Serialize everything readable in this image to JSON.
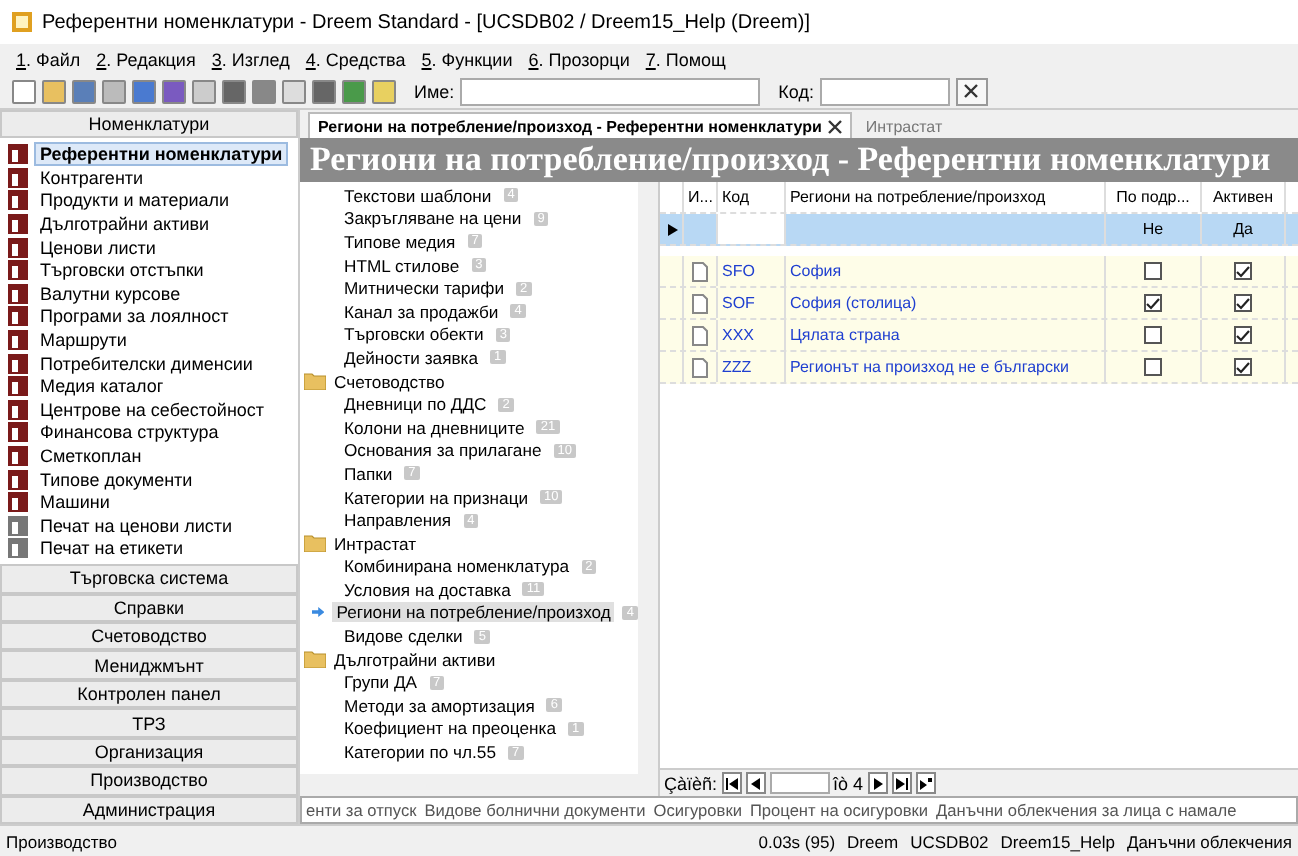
{
  "window": {
    "title": "Референтни номенклатури - Dreem Standard - [UCSDB02 / Dreem15_Help (Dreem)]"
  },
  "menu": [
    {
      "key": "1",
      "label": ". Файл"
    },
    {
      "key": "2",
      "label": ". Редакция"
    },
    {
      "key": "3",
      "label": ". Изглед"
    },
    {
      "key": "4",
      "label": ". Средства"
    },
    {
      "key": "5",
      "label": ". Функции"
    },
    {
      "key": "6",
      "label": ". Прозорци"
    },
    {
      "key": "7",
      "label": ". Помощ"
    }
  ],
  "toolbar": {
    "name_label": "Име:",
    "code_label": "Код:"
  },
  "sidebar": {
    "header": "Номенклатури",
    "items": [
      {
        "label": "Референтни номенклатури",
        "selected": true,
        "kind": "nomen"
      },
      {
        "label": "Контрагенти",
        "selected": false,
        "kind": "nomen"
      },
      {
        "label": "Продукти и материали",
        "selected": false,
        "kind": "nomen"
      },
      {
        "label": "Дълготрайни активи",
        "selected": false,
        "kind": "nomen"
      },
      {
        "label": "Ценови листи",
        "selected": false,
        "kind": "nomen"
      },
      {
        "label": "Търговски отстъпки",
        "selected": false,
        "kind": "nomen"
      },
      {
        "label": "Валутни курсове",
        "selected": false,
        "kind": "nomen"
      },
      {
        "label": "Програми за лоялност",
        "selected": false,
        "kind": "nomen"
      },
      {
        "label": "Маршрути",
        "selected": false,
        "kind": "nomen"
      },
      {
        "label": "Потребителски дименсии",
        "selected": false,
        "kind": "nomen"
      },
      {
        "label": "Медия каталог",
        "selected": false,
        "kind": "nomen"
      },
      {
        "label": "Центрове на себестойност",
        "selected": false,
        "kind": "nomen"
      },
      {
        "label": "Финансова структура",
        "selected": false,
        "kind": "nomen"
      },
      {
        "label": "Сметкоплан",
        "selected": false,
        "kind": "nomen"
      },
      {
        "label": "Типове документи",
        "selected": false,
        "kind": "nomen"
      },
      {
        "label": "Машини",
        "selected": false,
        "kind": "nomen"
      },
      {
        "label": "Печат на ценови листи",
        "selected": false,
        "kind": "print"
      },
      {
        "label": "Печат на етикети",
        "selected": false,
        "kind": "print"
      }
    ],
    "groups": [
      "Търговска система",
      "Справки",
      "Счетоводство",
      "Мениджмънт",
      "Контролен панел",
      "ТРЗ",
      "Организация",
      "Производство",
      "Администрация"
    ]
  },
  "tabs": [
    {
      "label": "Региони на потребление/произход - Референтни номенклатури",
      "selected": true
    },
    {
      "label": "Интрастат",
      "selected": false
    }
  ],
  "banner": "Региони на потребление/произход - Референтни номенклатури",
  "tree": [
    {
      "label": "Текстови шаблони",
      "count": "4",
      "selected": false
    },
    {
      "label": "Закръгляване на цени",
      "count": "9",
      "selected": false
    },
    {
      "label": "Типове медия",
      "count": "7",
      "selected": false
    },
    {
      "label": "HTML стилове",
      "count": "3",
      "selected": false
    },
    {
      "label": "Митнически тарифи",
      "count": "2",
      "selected": false
    },
    {
      "label": "Канал за продажби",
      "count": "4",
      "selected": false
    },
    {
      "label": "Търговски обекти",
      "count": "3",
      "selected": false
    },
    {
      "label": "Дейности заявка",
      "count": "1",
      "selected": false
    },
    {
      "label": "Счетоводство",
      "children": [
        {
          "label": "Дневници по ДДС",
          "count": "2",
          "selected": false
        },
        {
          "label": "Колони на дневниците",
          "count": "21",
          "selected": false
        },
        {
          "label": "Основания за прилагане",
          "count": "10",
          "selected": false
        },
        {
          "label": "Папки",
          "count": "7",
          "selected": false
        },
        {
          "label": "Категории на признаци",
          "count": "10",
          "selected": false
        },
        {
          "label": "Направления",
          "count": "4",
          "selected": false
        }
      ]
    },
    {
      "label": "Интрастат",
      "children": [
        {
          "label": "Комбинирана номенклатура",
          "count": "2",
          "selected": false
        },
        {
          "label": "Условия на доставка",
          "count": "11",
          "selected": false
        },
        {
          "label": "Региони на потребление/произход",
          "count": "4",
          "selected": true
        },
        {
          "label": "Видове сделки",
          "count": "5",
          "selected": false
        }
      ]
    },
    {
      "label": "Дълготрайни активи",
      "children": [
        {
          "label": "Групи ДА",
          "count": "7",
          "selected": false
        },
        {
          "label": "Методи за амортизация",
          "count": "6",
          "selected": false
        },
        {
          "label": "Коефициент на преоценка",
          "count": "1",
          "selected": false
        },
        {
          "label": "Категории по чл.55",
          "count": "7",
          "selected": false
        }
      ]
    }
  ],
  "bottom_tabs": [
    "енти за отпуск",
    "Видове болнични документи",
    "Осигуровки",
    "Процент на осигуровки",
    "Данъчни облекчения за лица с намале"
  ],
  "table": {
    "columns": [
      "И...",
      "Код",
      "Региони на потребление/произход",
      "По подр...",
      "Активен"
    ],
    "filter_row": {
      "col_4": "Не",
      "col_5": "Да"
    },
    "rows": [
      {
        "code": "SFO",
        "name": "София",
        "default": false,
        "active": true
      },
      {
        "code": "SOF",
        "name": "София (столица)",
        "default": true,
        "active": true
      },
      {
        "code": "XXX",
        "name": "Цялата страна",
        "default": false,
        "active": true
      },
      {
        "code": "ZZZ",
        "name": "Регионът на произход не е български",
        "default": false,
        "active": true
      }
    ]
  },
  "navigator": {
    "label": "Çàïèñ:",
    "total": "îò 4"
  },
  "status_bar": [
    "Производство",
    "0.03s (95)",
    "Dreem",
    "UCSDB02",
    "Dreem15_Help",
    "Данъчни облекчения"
  ]
}
